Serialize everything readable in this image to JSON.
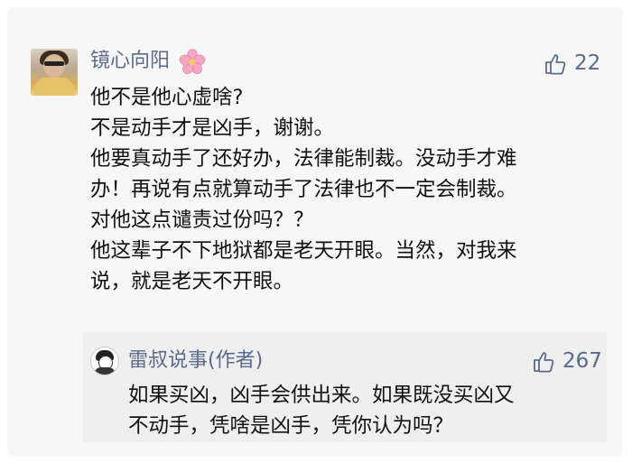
{
  "comment": {
    "author": "镜心向阳",
    "author_emoji_icon": "cherry-blossom-icon",
    "likes": "22",
    "lines": [
      "他不是他心虚啥?",
      "不是动手才是凶手，谢谢。",
      "他要真动手了还好办，法律能制裁。没动手才难",
      "办！再说有点就算动手了法律也不一定会制裁。",
      "对他这点谴责过份吗？？",
      "他这辈子不下地狱都是老天开眼。当然，对我来",
      "说，就是老天不开眼。"
    ]
  },
  "reply": {
    "author": "雷叔说事(作者)",
    "likes": "267",
    "lines": [
      "如果买凶，凶手会供出来。如果既没买凶又",
      "不动手，凭啥是凶手，凭你认为吗？"
    ]
  },
  "colors": {
    "name": "#5b6b8c",
    "text": "#111111",
    "card_bg": "#f7f7f7",
    "reply_bg": "#efefef"
  }
}
